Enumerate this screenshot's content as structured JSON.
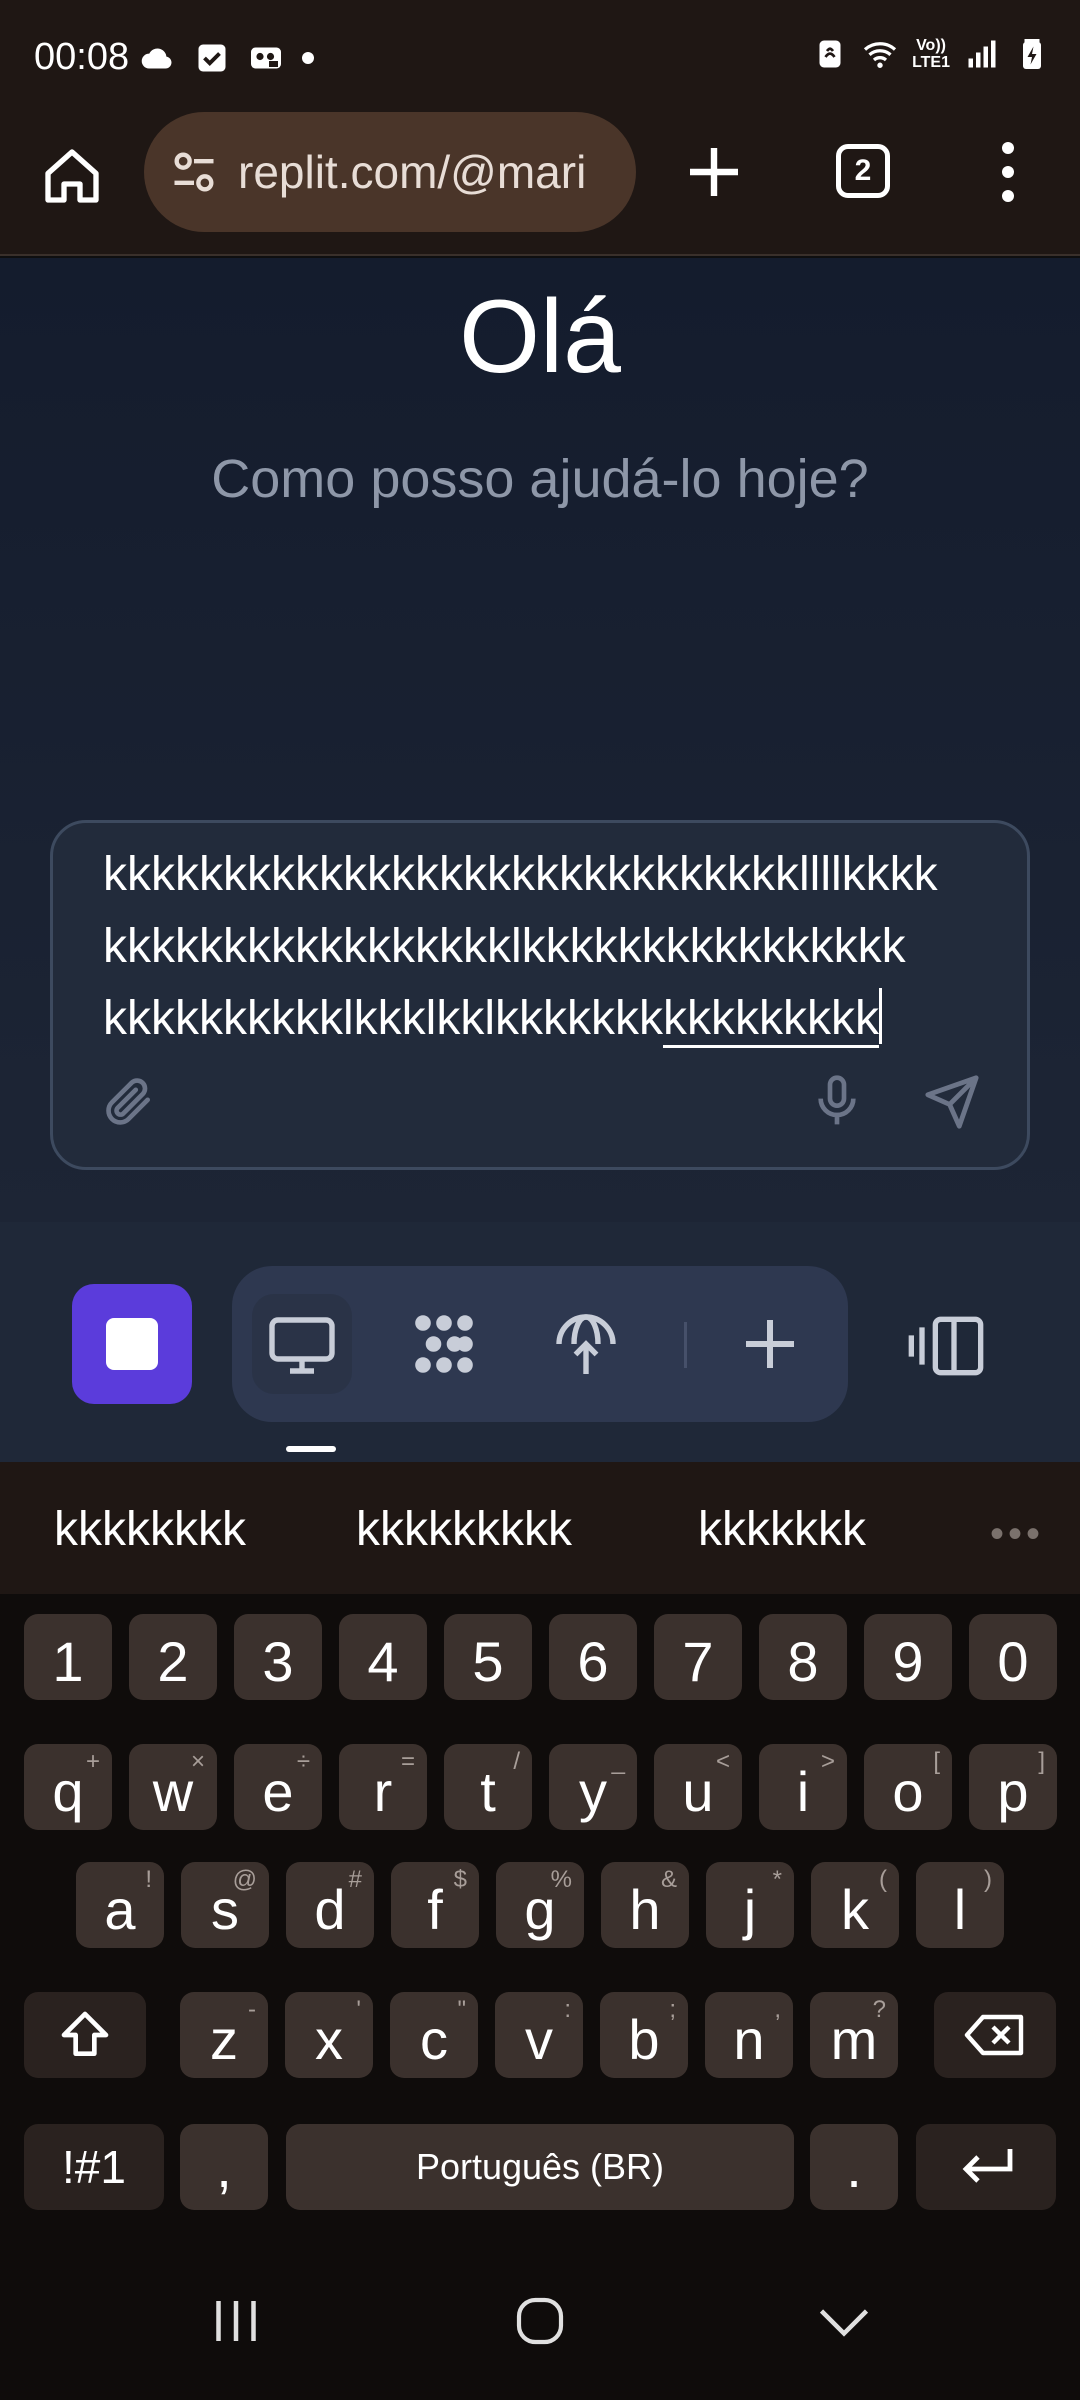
{
  "status_bar": {
    "time": "00:08",
    "left_icons": [
      "cloud-icon",
      "check-box-icon",
      "voicemail-icon"
    ],
    "right_icons": [
      "nfc-icon",
      "wifi-icon",
      "volte-icon",
      "signal-icon",
      "battery-charging-icon"
    ],
    "volte_line1": "Vo))",
    "volte_line2": "LTE1"
  },
  "browser": {
    "url": "replit.com/@mari",
    "tab_count": "2",
    "icons": [
      "home-icon",
      "site-settings-icon",
      "new-tab-plus-icon",
      "tab-switcher-icon",
      "more-menu-icon"
    ]
  },
  "page": {
    "greeting": "Olá",
    "subtitle": "Como posso ajudá-lo hoje?"
  },
  "chat_input": {
    "line1": "kkkkkkkkkkkkkkkkkkkkkkkkkkkkkllllkkkk",
    "line2": "kkkkkkkkkkkkkkkkklkkkkkkkkkkkkkkkk",
    "line3_plain": "kkkkkkkkkklkkklkklkkkkkkk",
    "line3_underlined": "kkkkkkkkk",
    "icons": [
      "attach-icon",
      "microphone-icon",
      "send-icon"
    ]
  },
  "replit_bar": {
    "accent": "#5b3cdb",
    "tools": [
      "preview-desktop-icon",
      "agent-icon",
      "deploy-icon",
      "add-tool-icon"
    ],
    "panel_icon": "panel-toggle-icon"
  },
  "keyboard": {
    "suggestions": [
      "kkkkkkkk",
      "kkkkkkkkk",
      "kkkkkkk"
    ],
    "row_numbers": [
      "1",
      "2",
      "3",
      "4",
      "5",
      "6",
      "7",
      "8",
      "9",
      "0"
    ],
    "row1": [
      {
        "k": "q",
        "s": "+"
      },
      {
        "k": "w",
        "s": "×"
      },
      {
        "k": "e",
        "s": "÷"
      },
      {
        "k": "r",
        "s": "="
      },
      {
        "k": "t",
        "s": "/"
      },
      {
        "k": "y",
        "s": "_"
      },
      {
        "k": "u",
        "s": "<"
      },
      {
        "k": "i",
        "s": ">"
      },
      {
        "k": "o",
        "s": "["
      },
      {
        "k": "p",
        "s": "]"
      }
    ],
    "row2": [
      {
        "k": "a",
        "s": "!"
      },
      {
        "k": "s",
        "s": "@"
      },
      {
        "k": "d",
        "s": "#"
      },
      {
        "k": "f",
        "s": "$"
      },
      {
        "k": "g",
        "s": "%"
      },
      {
        "k": "h",
        "s": "&"
      },
      {
        "k": "j",
        "s": "*"
      },
      {
        "k": "k",
        "s": "("
      },
      {
        "k": "l",
        "s": ")"
      }
    ],
    "row3": [
      {
        "k": "z",
        "s": "-"
      },
      {
        "k": "x",
        "s": "'"
      },
      {
        "k": "c",
        "s": "\""
      },
      {
        "k": "v",
        "s": ":"
      },
      {
        "k": "b",
        "s": ";"
      },
      {
        "k": "n",
        "s": ","
      },
      {
        "k": "m",
        "s": "?"
      }
    ],
    "symbols_key": "!#1",
    "comma_key": ",",
    "space_label": "Português (BR)",
    "period_key": ".",
    "icons": [
      "shift-icon",
      "backspace-icon",
      "enter-icon"
    ]
  },
  "nav_bar": {
    "icons": [
      "recent-apps-icon",
      "home-circle-icon",
      "hide-keyboard-icon"
    ]
  }
}
